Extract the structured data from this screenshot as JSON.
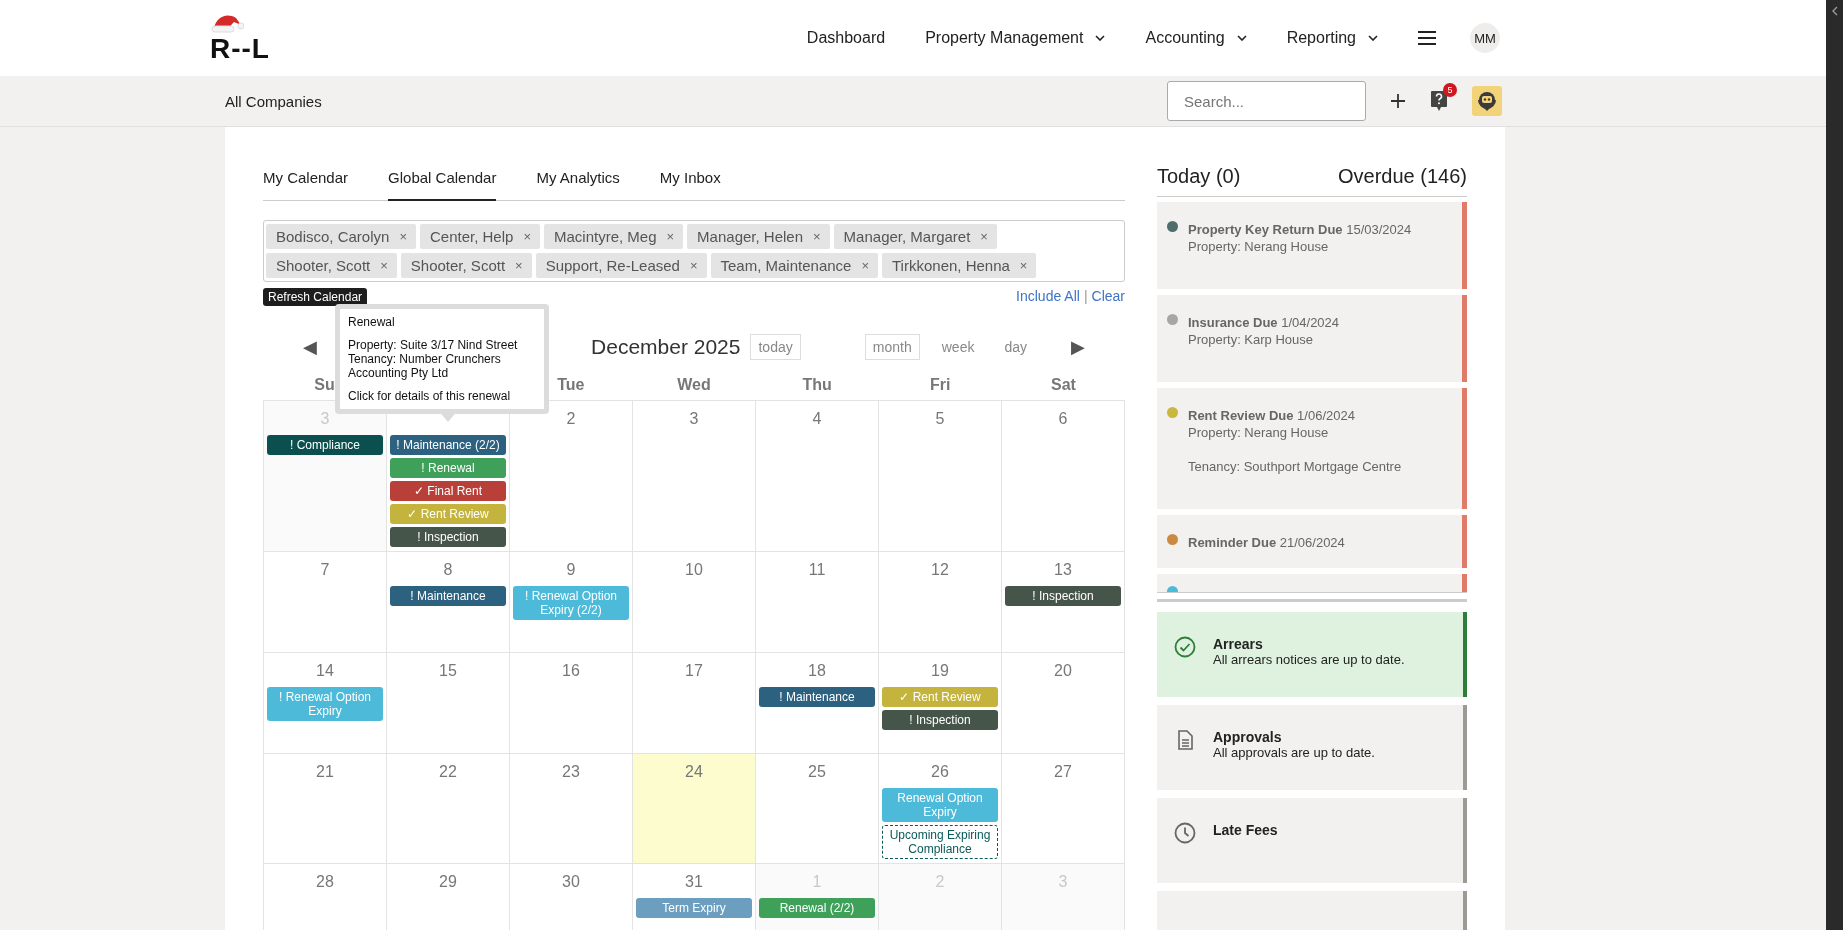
{
  "header": {
    "logo": "R--L",
    "nav": [
      {
        "label": "Dashboard",
        "dropdown": false
      },
      {
        "label": "Property Management",
        "dropdown": true
      },
      {
        "label": "Accounting",
        "dropdown": true
      },
      {
        "label": "Reporting",
        "dropdown": true
      }
    ],
    "avatar": "MM"
  },
  "subbar": {
    "company": "All Companies",
    "search": {
      "placeholder": "Search..."
    },
    "help_badge": "5"
  },
  "tabs": [
    {
      "label": "My Calendar",
      "selected": false
    },
    {
      "label": "Global Calendar",
      "selected": true
    },
    {
      "label": "My Analytics",
      "selected": false
    },
    {
      "label": "My Inbox",
      "selected": false
    }
  ],
  "filter": {
    "chips": [
      {
        "label": "Bodisco, Carolyn",
        "remove": "×"
      },
      {
        "label": "Center, Help",
        "remove": "×"
      },
      {
        "label": "Macintyre, Meg",
        "remove": "×"
      },
      {
        "label": "Manager, Helen",
        "remove": "×"
      },
      {
        "label": "Manager, Margaret",
        "remove": "×"
      },
      {
        "label": "Shooter, Scott",
        "remove": "×"
      },
      {
        "label": "Shooter, Scott",
        "remove": "×"
      },
      {
        "label": "Support, Re-Leased",
        "remove": "×"
      },
      {
        "label": "Team, Maintenance",
        "remove": "×"
      },
      {
        "label": "Tirkkonen, Henna",
        "remove": "×"
      }
    ],
    "refresh_button": "Refresh Calendar",
    "include_all": "Include All",
    "separator": "|",
    "clear": "Clear"
  },
  "calendar": {
    "prev": "◀",
    "title": "December 2025",
    "today_button": "today",
    "views": [
      {
        "label": "month",
        "selected": true
      },
      {
        "label": "week",
        "selected": false
      },
      {
        "label": "day",
        "selected": false
      }
    ],
    "next": "▶",
    "day_headers": [
      "Su",
      "Tue",
      "Wed",
      "Thu",
      "Fri",
      "Sat"
    ],
    "weeks": [
      [
        {
          "day": "3",
          "muted": true,
          "today": false,
          "events": [
            {
              "label": "! Compliance",
              "color": "#0b4f4f",
              "kind": "solid"
            }
          ]
        },
        {
          "today": false,
          "events": [
            {
              "label": "! Maintenance (2/2)",
              "color": "#2c6180",
              "kind": "solid"
            },
            {
              "label": "! Renewal",
              "color": "#3fa05a",
              "kind": "solid"
            },
            {
              "label": "✓ Final Rent",
              "color": "#b94038",
              "kind": "solid"
            },
            {
              "label": "✓ Rent Review",
              "color": "#c4b33c",
              "kind": "solid"
            },
            {
              "label": "! Inspection",
              "color": "#46554a",
              "kind": "solid"
            }
          ]
        },
        {
          "day": "2",
          "muted": false,
          "today": false
        },
        {
          "day": "3",
          "muted": false,
          "today": false
        },
        {
          "day": "4",
          "muted": false,
          "today": false
        },
        {
          "day": "5",
          "muted": false,
          "today": false
        },
        {
          "day": "6",
          "muted": false,
          "today": false
        }
      ],
      [
        {
          "day": "7",
          "muted": false,
          "today": false
        },
        {
          "day": "8",
          "muted": false,
          "today": false,
          "events": [
            {
              "label": "! Maintenance",
              "color": "#2c6180",
              "kind": "solid"
            }
          ]
        },
        {
          "day": "9",
          "muted": false,
          "today": false,
          "events": [
            {
              "label": "! Renewal Option Expiry (2/2)",
              "color": "#4cbad8",
              "kind": "solid"
            }
          ]
        },
        {
          "day": "10",
          "muted": false,
          "today": false
        },
        {
          "day": "11",
          "muted": false,
          "today": false
        },
        {
          "day": "12",
          "muted": false,
          "today": false
        },
        {
          "day": "13",
          "muted": false,
          "today": false,
          "events": [
            {
              "label": "! Inspection",
              "color": "#46554a",
              "kind": "solid"
            }
          ]
        }
      ],
      [
        {
          "day": "14",
          "muted": false,
          "today": false,
          "events": [
            {
              "label": "! Renewal Option Expiry",
              "color": "#4cbad8",
              "kind": "solid"
            }
          ]
        },
        {
          "day": "15",
          "muted": false,
          "today": false
        },
        {
          "day": "16",
          "muted": false,
          "today": false
        },
        {
          "day": "17",
          "muted": false,
          "today": false
        },
        {
          "day": "18",
          "muted": false,
          "today": false,
          "events": [
            {
              "label": "! Maintenance",
              "color": "#2c6180",
              "kind": "solid"
            }
          ]
        },
        {
          "day": "19",
          "muted": false,
          "today": false,
          "events": [
            {
              "label": "✓ Rent Review",
              "color": "#c4b33c",
              "kind": "solid"
            },
            {
              "label": "! Inspection",
              "color": "#46554a",
              "kind": "solid"
            }
          ]
        },
        {
          "day": "20",
          "muted": false,
          "today": false
        }
      ],
      [
        {
          "day": "21",
          "muted": false,
          "today": false
        },
        {
          "day": "22",
          "muted": false,
          "today": false
        },
        {
          "day": "23",
          "muted": false,
          "today": false
        },
        {
          "day": "24",
          "muted": false,
          "today": true
        },
        {
          "day": "25",
          "muted": false,
          "today": false
        },
        {
          "day": "26",
          "muted": false,
          "today": false,
          "events": [
            {
              "label": "Renewal Option Expiry",
              "color": "#4cbad8",
              "kind": "solid"
            },
            {
              "label": "Upcoming Expiring Compliance",
              "color": "#0b5a5a",
              "kind": "dashed"
            }
          ]
        },
        {
          "day": "27",
          "muted": false,
          "today": false
        }
      ],
      [
        {
          "day": "28",
          "muted": false,
          "today": false
        },
        {
          "day": "29",
          "muted": false,
          "today": false
        },
        {
          "day": "30",
          "muted": false,
          "today": false
        },
        {
          "day": "31",
          "muted": false,
          "today": false,
          "events": [
            {
              "label": "Term Expiry",
              "color": "#6c9ec0",
              "kind": "solid"
            }
          ]
        },
        {
          "day": "1",
          "muted": true,
          "today": false,
          "events": [
            {
              "label": "Renewal (2/2)",
              "color": "#3fa05a",
              "kind": "solid"
            }
          ]
        },
        {
          "day": "2",
          "muted": true,
          "today": false
        },
        {
          "day": "3",
          "muted": true,
          "today": false
        }
      ]
    ]
  },
  "tooltip": {
    "title": "Renewal",
    "details": [
      "Property: Suite 3/17 Nind Street",
      "Tenancy: Number Crunchers Accounting Pty Ltd"
    ],
    "footer": "Click for details of this renewal"
  },
  "right": {
    "today": "Today (0)",
    "overdue": "Overdue (146)",
    "items": [
      {
        "title": "Property Key Return Due",
        "date": "15/03/2024",
        "color": "#4d6e6c",
        "paragraphs": [
          [
            "Property: Nerang House"
          ]
        ]
      },
      {
        "title": "Insurance Due",
        "date": "1/04/2024",
        "color": "#a6a6a6",
        "paragraphs": [
          [
            "Property: Karp House"
          ]
        ]
      },
      {
        "title": "Rent Review Due",
        "date": "1/06/2024",
        "color": "#c9b73e",
        "paragraphs": [
          [
            "Property: Nerang House"
          ],
          [
            "Tenancy: Southport Mortgage Centre"
          ]
        ]
      },
      {
        "title": "Reminder Due",
        "date": "21/06/2024",
        "color": "#c98a44"
      },
      {
        "color": "#4cbad8"
      }
    ],
    "status": [
      {
        "kind": "ok",
        "title": "Arrears",
        "text": "All arrears notices are up to date."
      },
      {
        "kind": "pending",
        "title": "Approvals",
        "text": "All approvals are up to date."
      },
      {
        "kind": "pending",
        "title": "Late Fees"
      },
      {
        "kind": "pending"
      }
    ]
  }
}
